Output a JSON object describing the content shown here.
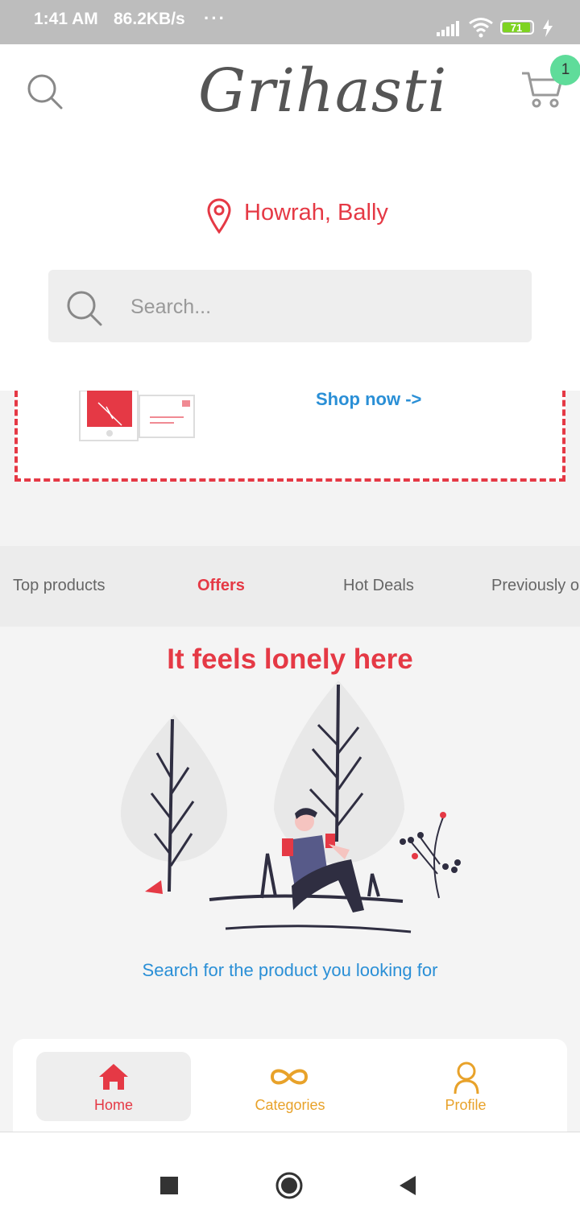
{
  "status_bar": {
    "time": "1:41 AM",
    "speed": "86.2KB/s",
    "dots": "···",
    "battery": "71"
  },
  "header": {
    "logo": "Grihasti",
    "cart_count": "1",
    "location": "Howrah, Bally"
  },
  "search": {
    "placeholder": "Search..."
  },
  "banner": {
    "cta": "Shop now ->"
  },
  "tabs": [
    {
      "label": "Top products",
      "active": false
    },
    {
      "label": "Offers",
      "active": true
    },
    {
      "label": "Hot Deals",
      "active": false
    },
    {
      "label": "Previously o",
      "active": false
    }
  ],
  "empty_state": {
    "title": "It feels lonely here",
    "subtitle": "Search for the product you looking for"
  },
  "bottom_nav": [
    {
      "label": "Home",
      "icon": "home-icon",
      "active": true
    },
    {
      "label": "Categories",
      "icon": "infinity-icon",
      "active": false
    },
    {
      "label": "Profile",
      "icon": "person-icon",
      "active": false
    }
  ],
  "colors": {
    "accent": "#e53945",
    "link": "#2a8fd6",
    "nav_inactive": "#e8a22a",
    "badge": "#5fdc9a"
  }
}
